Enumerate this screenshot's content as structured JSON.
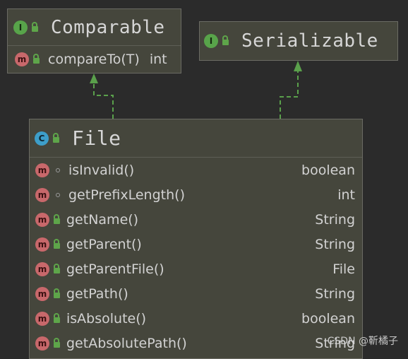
{
  "diagram": {
    "colors": {
      "background": "#2b2b2b",
      "node_fill": "#45463c",
      "node_border": "#6b6b64",
      "edge": "#5aa04b",
      "interface_badge": "#58a44a",
      "class_badge": "#3d9ec9",
      "method_badge": "#c8686b"
    },
    "nodes": {
      "comparable": {
        "kind": "interface",
        "badge": "I",
        "title": "Comparable",
        "members": [
          {
            "badge": "m",
            "visibility": "public",
            "name": "compareTo(T)",
            "type": "int"
          }
        ]
      },
      "serializable": {
        "kind": "interface",
        "badge": "I",
        "title": "Serializable",
        "members": []
      },
      "file": {
        "kind": "class",
        "badge": "C",
        "title": "File",
        "members": [
          {
            "badge": "m",
            "visibility": "package",
            "name": "isInvalid()",
            "type": "boolean"
          },
          {
            "badge": "m",
            "visibility": "package",
            "name": "getPrefixLength()",
            "type": "int"
          },
          {
            "badge": "m",
            "visibility": "public",
            "name": "getName()",
            "type": "String"
          },
          {
            "badge": "m",
            "visibility": "public",
            "name": "getParent()",
            "type": "String"
          },
          {
            "badge": "m",
            "visibility": "public",
            "name": "getParentFile()",
            "type": "File"
          },
          {
            "badge": "m",
            "visibility": "public",
            "name": "getPath()",
            "type": "String"
          },
          {
            "badge": "m",
            "visibility": "public",
            "name": "isAbsolute()",
            "type": "boolean"
          },
          {
            "badge": "m",
            "visibility": "public",
            "name": "getAbsolutePath()",
            "type": "String"
          }
        ]
      }
    },
    "edges": [
      {
        "from": "file",
        "to": "comparable",
        "kind": "implements"
      },
      {
        "from": "file",
        "to": "serializable",
        "kind": "implements"
      }
    ]
  },
  "watermark": "CSDN @靳橘子"
}
